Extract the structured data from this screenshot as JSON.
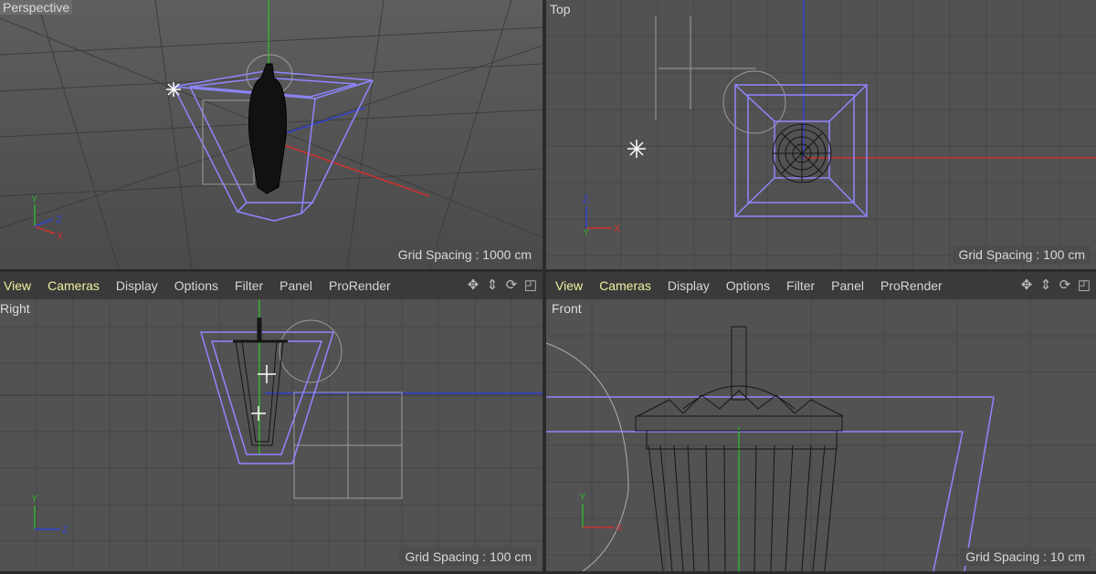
{
  "viewports": {
    "perspective": {
      "label": "Perspective",
      "grid_spacing": "Grid Spacing : 1000 cm"
    },
    "top": {
      "label": "Top",
      "grid_spacing": "Grid Spacing : 100 cm"
    },
    "right": {
      "label": "Right",
      "grid_spacing": "Grid Spacing : 100 cm"
    },
    "front": {
      "label": "Front",
      "grid_spacing": "Grid Spacing : 10 cm"
    }
  },
  "menu": {
    "items": [
      "View",
      "Cameras",
      "Display",
      "Options",
      "Filter",
      "Panel",
      "ProRender"
    ]
  },
  "axes": {
    "x": "X",
    "y": "Y",
    "z": "Z"
  },
  "colors": {
    "x_axis": "#d03030",
    "y_axis": "#30b030",
    "z_axis": "#3040d0",
    "selection": "#8f86ff",
    "highlight_menu": "#f0f0a0"
  },
  "icons": [
    "move-icon",
    "zoom-icon",
    "rotate-icon",
    "maximize-icon"
  ]
}
